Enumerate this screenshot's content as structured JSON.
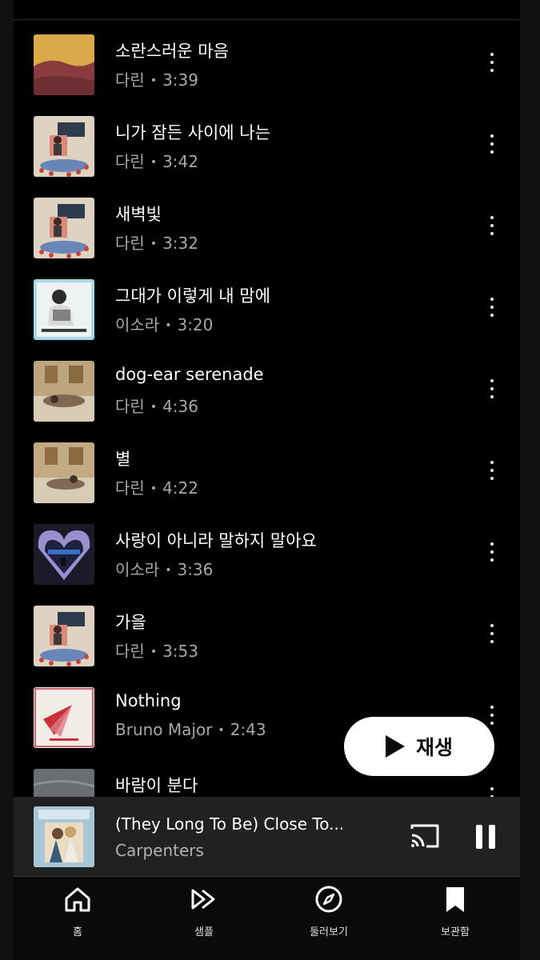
{
  "tracks": [
    {
      "title": "소란스러운 마음",
      "artist": "다린",
      "duration": "3:39",
      "art": "sunset-hill"
    },
    {
      "title": "니가 잠든 사이에 나는",
      "artist": "다린",
      "duration": "3:42",
      "art": "red-chair"
    },
    {
      "title": "새벽빛",
      "artist": "다린",
      "duration": "3:32",
      "art": "red-chair"
    },
    {
      "title": "그대가 이렇게 내 맘에",
      "artist": "이소라",
      "duration": "3:20",
      "art": "portrait-blue"
    },
    {
      "title": "dog-ear serenade",
      "artist": "다린",
      "duration": "4:36",
      "art": "beige-room"
    },
    {
      "title": "별",
      "artist": "다린",
      "duration": "4:22",
      "art": "beige-room"
    },
    {
      "title": "사랑이 아니라 말하지 말아요",
      "artist": "이소라",
      "duration": "3:36",
      "art": "purple-heart"
    },
    {
      "title": "가을",
      "artist": "다린",
      "duration": "3:53",
      "art": "red-chair"
    },
    {
      "title": "Nothing",
      "artist": "Bruno Major",
      "duration": "2:43",
      "art": "red-fan"
    },
    {
      "title": "바람이 분다",
      "artist": "",
      "duration": "",
      "art": "grey-sky"
    }
  ],
  "play_button": {
    "label": "재생"
  },
  "mini_player": {
    "title": "(They Long To Be) Close To...",
    "artist": "Carpenters"
  },
  "nav": {
    "home": "홈",
    "samples": "샘플",
    "explore": "둘러보기",
    "library": "보관함"
  },
  "separator": "•"
}
